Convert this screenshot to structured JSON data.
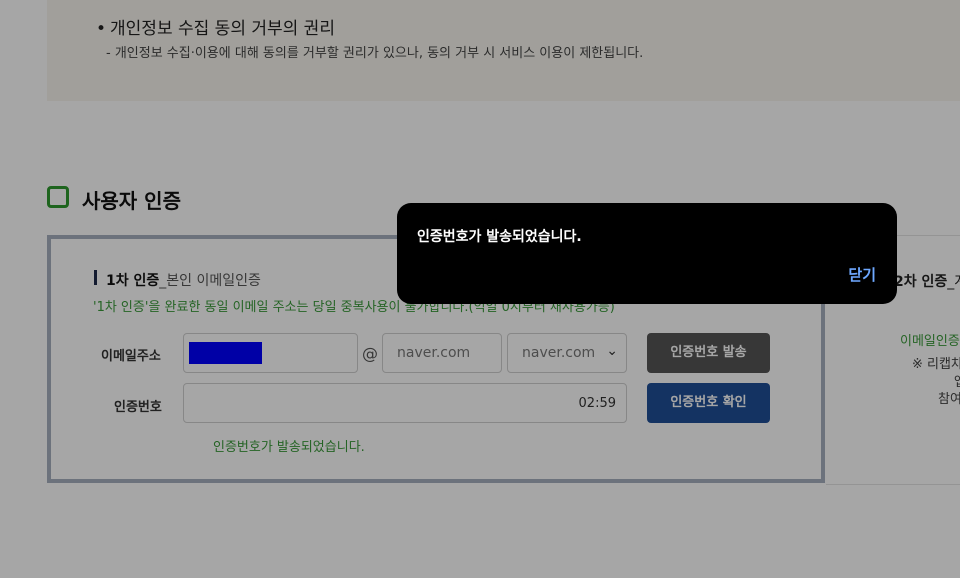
{
  "notice": {
    "bullet": "•",
    "title": "개인정보 수집 동의 거부의 권리",
    "description": "- 개인정보 수집·이용에 대해 동의를 거부할 권리가 있으나, 동의 거부 시 서비스 이용이 제한됩니다."
  },
  "section": {
    "title": "사용자 인증"
  },
  "step1": {
    "title": "1차 인증",
    "subtitle": "_본인 이메일인증",
    "note": "'1차 인증'을 완료한 동일 이메일 주소는 당일 중복사용이 불가합니다.(익일 0시부터 재사용가능)",
    "email_label": "이메일주소",
    "at_sign": "@",
    "domain_placeholder": "naver.com",
    "domain_selected": "naver.com",
    "send_button": "인증번호 발송",
    "code_label": "인증번호",
    "timer": "02:59",
    "confirm_button": "인증번호 확인",
    "sent_message": "인증번호가 발송되었습니다."
  },
  "step2": {
    "title_prefix": "2차 인증",
    "title_suffix": "_계",
    "line1": "이메일인증",
    "line2": "※ 리캡차",
    "line3": "앱",
    "line4": "참여"
  },
  "dialog": {
    "message": "인증번호가 발송되었습니다.",
    "close_label": "닫기"
  },
  "colors": {
    "accent_green": "#2f9a2f",
    "confirm_blue": "#1f4f97",
    "send_gray": "#555555",
    "mask_blue": "#0000ff"
  }
}
